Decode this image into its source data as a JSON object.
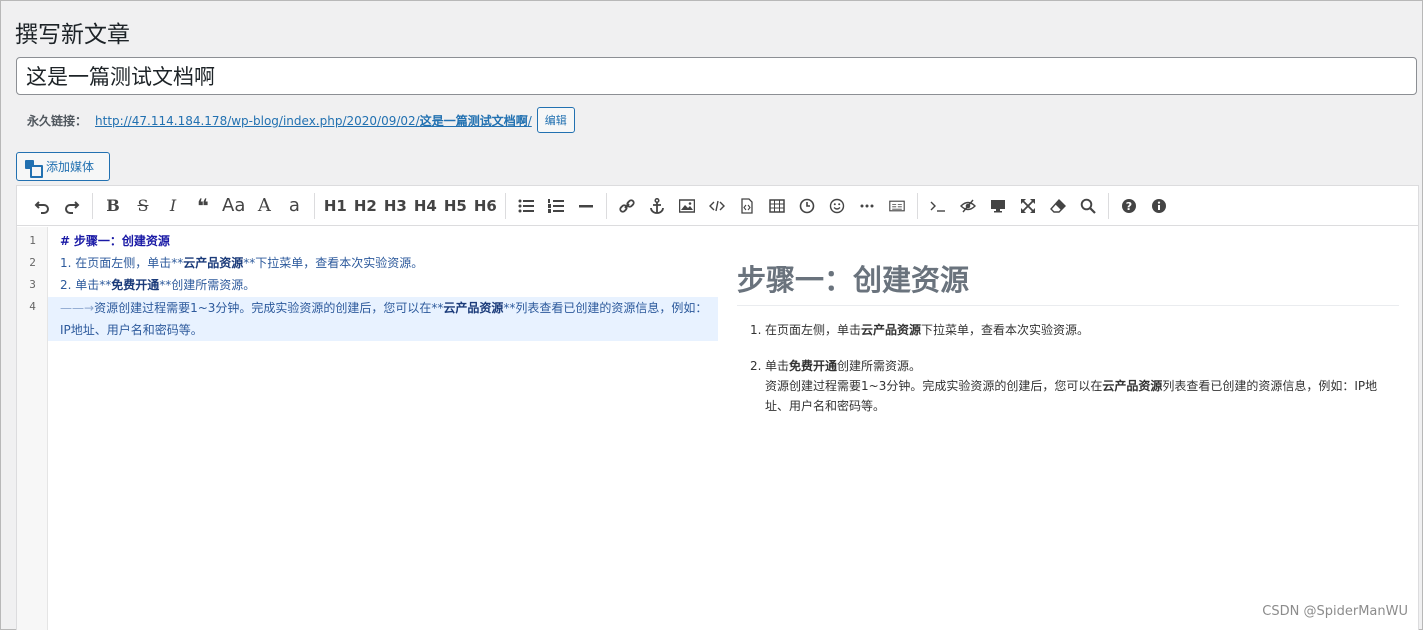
{
  "page_title": "撰写新文章",
  "post_title": "这是一篇测试文档啊",
  "permalink": {
    "label": "永久链接：",
    "url_prefix": "http://47.114.184.178/wp-blog/index.php/2020/09/02/",
    "url_slug": "这是一篇测试文档啊",
    "url_suffix": "/",
    "edit_label": "编辑"
  },
  "add_media_label": "添加媒体",
  "toolbar": {
    "headings": [
      "H1",
      "H2",
      "H3",
      "H4",
      "H5",
      "H6"
    ],
    "font_aa": "Aa",
    "font_a_big": "A",
    "font_a_small": "a"
  },
  "code_lines": {
    "line_numbers": [
      "1",
      "2",
      "3",
      "4"
    ],
    "l1_hash": "#",
    "l1_text": "步骤一：创建资源",
    "l2_prefix": "1. 在页面左侧，单击**",
    "l2_bold": "云产品资源",
    "l2_suffix": "**下拉菜单，查看本次实验资源。",
    "l3_prefix": "2. 单击**",
    "l3_bold": "免费开通",
    "l3_suffix": "**创建所需资源。",
    "l4_arrow": "——→",
    "l4_prefix": "资源创建过程需要1~3分钟。完成实验资源的创建后，您可以在**",
    "l4_bold": "云产品资源",
    "l4_suffix": "**列表查看已创建的资源信息，例如：IP地址、用户名和密码等。"
  },
  "preview": {
    "h1": "步骤一：创建资源",
    "item1_num": "1.",
    "item1_prefix": "在页面左侧，单击",
    "item1_bold": "云产品资源",
    "item1_suffix": "下拉菜单，查看本次实验资源。",
    "item2_num": "2.",
    "item2_prefix": "单击",
    "item2_bold": "免费开通",
    "item2_suffix": "创建所需资源。",
    "item2_p2_prefix": "资源创建过程需要1~3分钟。完成实验资源的创建后，您可以在",
    "item2_p2_bold": "云产品资源",
    "item2_p2_suffix": "列表查看已创建的资源信息，例如：IP地址、用户名和密码等。"
  },
  "watermark": "CSDN @SpiderManWU"
}
